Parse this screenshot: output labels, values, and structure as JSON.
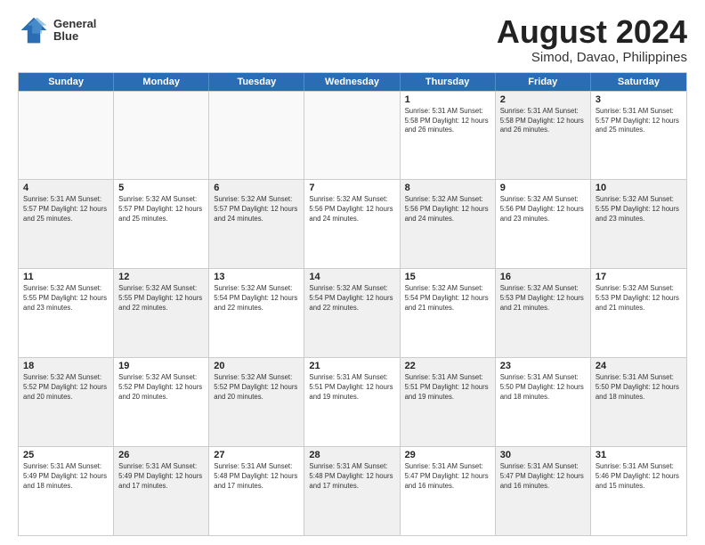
{
  "header": {
    "logo_line1": "General",
    "logo_line2": "Blue",
    "title": "August 2024",
    "subtitle": "Simod, Davao, Philippines"
  },
  "weekdays": [
    "Sunday",
    "Monday",
    "Tuesday",
    "Wednesday",
    "Thursday",
    "Friday",
    "Saturday"
  ],
  "weeks": [
    [
      {
        "day": "",
        "info": "",
        "empty": true
      },
      {
        "day": "",
        "info": "",
        "empty": true
      },
      {
        "day": "",
        "info": "",
        "empty": true
      },
      {
        "day": "",
        "info": "",
        "empty": true
      },
      {
        "day": "1",
        "info": "Sunrise: 5:31 AM\nSunset: 5:58 PM\nDaylight: 12 hours\nand 26 minutes."
      },
      {
        "day": "2",
        "info": "Sunrise: 5:31 AM\nSunset: 5:58 PM\nDaylight: 12 hours\nand 26 minutes.",
        "shaded": true
      },
      {
        "day": "3",
        "info": "Sunrise: 5:31 AM\nSunset: 5:57 PM\nDaylight: 12 hours\nand 25 minutes."
      }
    ],
    [
      {
        "day": "4",
        "info": "Sunrise: 5:31 AM\nSunset: 5:57 PM\nDaylight: 12 hours\nand 25 minutes.",
        "shaded": true
      },
      {
        "day": "5",
        "info": "Sunrise: 5:32 AM\nSunset: 5:57 PM\nDaylight: 12 hours\nand 25 minutes."
      },
      {
        "day": "6",
        "info": "Sunrise: 5:32 AM\nSunset: 5:57 PM\nDaylight: 12 hours\nand 24 minutes.",
        "shaded": true
      },
      {
        "day": "7",
        "info": "Sunrise: 5:32 AM\nSunset: 5:56 PM\nDaylight: 12 hours\nand 24 minutes."
      },
      {
        "day": "8",
        "info": "Sunrise: 5:32 AM\nSunset: 5:56 PM\nDaylight: 12 hours\nand 24 minutes.",
        "shaded": true
      },
      {
        "day": "9",
        "info": "Sunrise: 5:32 AM\nSunset: 5:56 PM\nDaylight: 12 hours\nand 23 minutes."
      },
      {
        "day": "10",
        "info": "Sunrise: 5:32 AM\nSunset: 5:55 PM\nDaylight: 12 hours\nand 23 minutes.",
        "shaded": true
      }
    ],
    [
      {
        "day": "11",
        "info": "Sunrise: 5:32 AM\nSunset: 5:55 PM\nDaylight: 12 hours\nand 23 minutes."
      },
      {
        "day": "12",
        "info": "Sunrise: 5:32 AM\nSunset: 5:55 PM\nDaylight: 12 hours\nand 22 minutes.",
        "shaded": true
      },
      {
        "day": "13",
        "info": "Sunrise: 5:32 AM\nSunset: 5:54 PM\nDaylight: 12 hours\nand 22 minutes."
      },
      {
        "day": "14",
        "info": "Sunrise: 5:32 AM\nSunset: 5:54 PM\nDaylight: 12 hours\nand 22 minutes.",
        "shaded": true
      },
      {
        "day": "15",
        "info": "Sunrise: 5:32 AM\nSunset: 5:54 PM\nDaylight: 12 hours\nand 21 minutes."
      },
      {
        "day": "16",
        "info": "Sunrise: 5:32 AM\nSunset: 5:53 PM\nDaylight: 12 hours\nand 21 minutes.",
        "shaded": true
      },
      {
        "day": "17",
        "info": "Sunrise: 5:32 AM\nSunset: 5:53 PM\nDaylight: 12 hours\nand 21 minutes."
      }
    ],
    [
      {
        "day": "18",
        "info": "Sunrise: 5:32 AM\nSunset: 5:52 PM\nDaylight: 12 hours\nand 20 minutes.",
        "shaded": true
      },
      {
        "day": "19",
        "info": "Sunrise: 5:32 AM\nSunset: 5:52 PM\nDaylight: 12 hours\nand 20 minutes."
      },
      {
        "day": "20",
        "info": "Sunrise: 5:32 AM\nSunset: 5:52 PM\nDaylight: 12 hours\nand 20 minutes.",
        "shaded": true
      },
      {
        "day": "21",
        "info": "Sunrise: 5:31 AM\nSunset: 5:51 PM\nDaylight: 12 hours\nand 19 minutes."
      },
      {
        "day": "22",
        "info": "Sunrise: 5:31 AM\nSunset: 5:51 PM\nDaylight: 12 hours\nand 19 minutes.",
        "shaded": true
      },
      {
        "day": "23",
        "info": "Sunrise: 5:31 AM\nSunset: 5:50 PM\nDaylight: 12 hours\nand 18 minutes."
      },
      {
        "day": "24",
        "info": "Sunrise: 5:31 AM\nSunset: 5:50 PM\nDaylight: 12 hours\nand 18 minutes.",
        "shaded": true
      }
    ],
    [
      {
        "day": "25",
        "info": "Sunrise: 5:31 AM\nSunset: 5:49 PM\nDaylight: 12 hours\nand 18 minutes."
      },
      {
        "day": "26",
        "info": "Sunrise: 5:31 AM\nSunset: 5:49 PM\nDaylight: 12 hours\nand 17 minutes.",
        "shaded": true
      },
      {
        "day": "27",
        "info": "Sunrise: 5:31 AM\nSunset: 5:48 PM\nDaylight: 12 hours\nand 17 minutes."
      },
      {
        "day": "28",
        "info": "Sunrise: 5:31 AM\nSunset: 5:48 PM\nDaylight: 12 hours\nand 17 minutes.",
        "shaded": true
      },
      {
        "day": "29",
        "info": "Sunrise: 5:31 AM\nSunset: 5:47 PM\nDaylight: 12 hours\nand 16 minutes."
      },
      {
        "day": "30",
        "info": "Sunrise: 5:31 AM\nSunset: 5:47 PM\nDaylight: 12 hours\nand 16 minutes.",
        "shaded": true
      },
      {
        "day": "31",
        "info": "Sunrise: 5:31 AM\nSunset: 5:46 PM\nDaylight: 12 hours\nand 15 minutes."
      }
    ]
  ]
}
